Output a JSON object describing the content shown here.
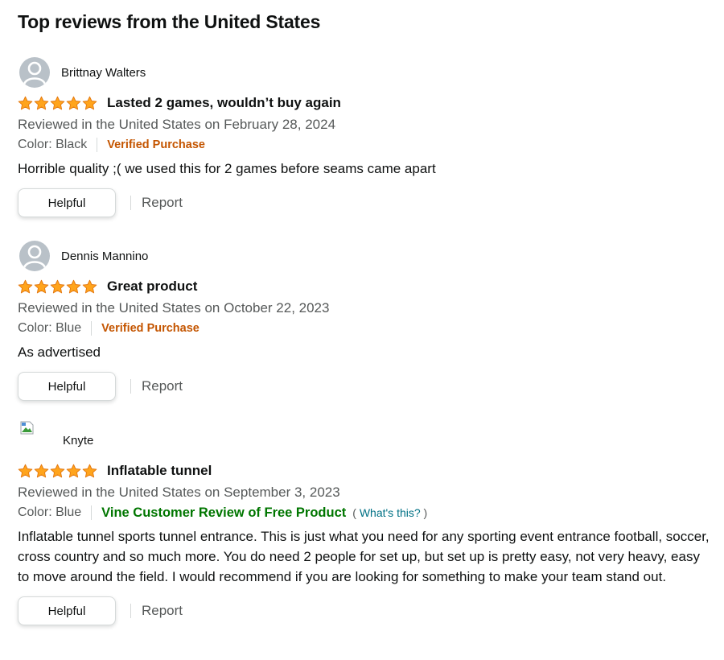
{
  "section": {
    "title": "Top reviews from the United States"
  },
  "colors": {
    "star": "#ffa41c",
    "verified": "#c45500",
    "vine": "#007600",
    "link": "#007185"
  },
  "reviews": [
    {
      "profile_name": "Brittnay Walters",
      "avatar": "default-avatar-icon",
      "rating": 5,
      "title": "Lasted 2 games, wouldn’t buy again",
      "date": "Reviewed in the United States on February 28, 2024",
      "color": "Color: Black",
      "badge": "Verified Purchase",
      "body": "Horrible quality ;( we used this for 2 games before seams came apart",
      "helpful_label": "Helpful",
      "report_label": "Report"
    },
    {
      "profile_name": "Dennis Mannino",
      "avatar": "default-avatar-icon",
      "rating": 5,
      "title": "Great product",
      "date": "Reviewed in the United States on October 22, 2023",
      "color": "Color: Blue",
      "badge": "Verified Purchase",
      "body": "As advertised",
      "helpful_label": "Helpful",
      "report_label": "Report"
    },
    {
      "profile_name": "Knyte",
      "avatar": "broken-image-icon",
      "rating": 5,
      "title": "Inflatable tunnel",
      "date": "Reviewed in the United States on September 3, 2023",
      "color": "Color: Blue",
      "badge": "Vine Customer Review of Free Product",
      "whats_this_open": "(",
      "whats_this": "What's this?",
      "whats_this_close": ")",
      "body": "Inflatable tunnel sports tunnel entrance. This is just what you need for any sporting event entrance football, soccer, cross country and so much more. You do need 2 people for set up, but set up is pretty easy, not very heavy, easy to move around the field. I would recommend if you are looking for something to make your team stand out.",
      "helpful_label": "Helpful",
      "report_label": "Report"
    }
  ]
}
